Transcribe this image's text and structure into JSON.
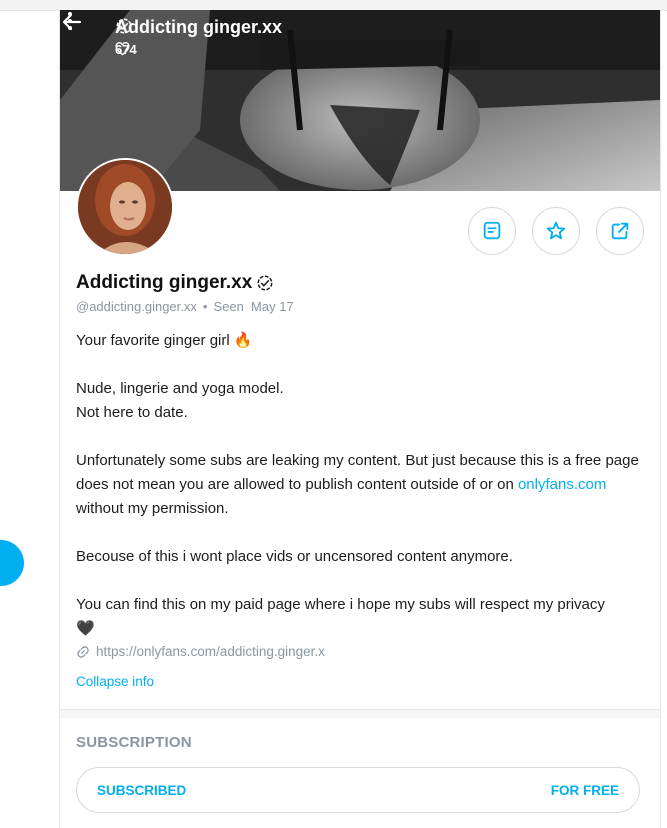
{
  "header": {
    "title": "Addicting ginger.xx",
    "likes": "674"
  },
  "profile": {
    "name": "Addicting ginger.xx",
    "handle": "@addicting.ginger.xx",
    "separator": "•",
    "seen": "Seen  May 17"
  },
  "bio": {
    "line1": "Your favorite ginger girl 🔥",
    "line2": "Nude, lingerie and yoga model.",
    "line3": "Not here to date.",
    "line4_before": "Unfortunately some subs are leaking my content. But just because this is a free page does not mean you are allowed to publish content outside of or on ",
    "line4_link": "onlyfans.com",
    "line4_after": " without my permission.",
    "line5": "Becouse of this i wont place vids or uncensored content anymore.",
    "line6": "You can find this on my paid page where i hope my subs will respect my privacy",
    "line6_heart": "🖤"
  },
  "link": {
    "url": "https://onlyfans.com/addicting.ginger.x"
  },
  "collapse_label": "Collapse info",
  "subscription": {
    "title": "SUBSCRIPTION",
    "status": "SUBSCRIBED",
    "price": "FOR FREE"
  },
  "icons": [
    "back-arrow-icon",
    "heart-icon",
    "more-vertical-icon",
    "verified-icon",
    "message-icon",
    "star-icon",
    "share-icon",
    "link-icon"
  ],
  "colors": {
    "accent": "#00aff0",
    "muted": "#8a96a3"
  }
}
